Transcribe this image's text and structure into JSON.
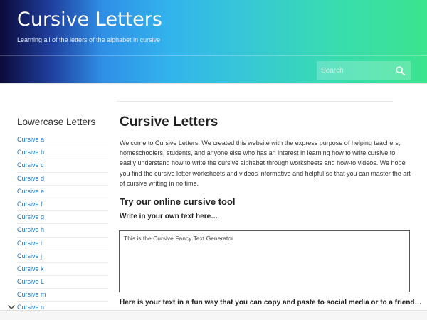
{
  "header": {
    "site_title": "Cursive Letters",
    "site_description": "Learning all of the letters of the alphabet in cursive",
    "search": {
      "placeholder": "Search",
      "icon": "search-icon"
    }
  },
  "sidebar": {
    "title": "Lowercase Letters",
    "items": [
      {
        "label": "Cursive a"
      },
      {
        "label": "Cursive b"
      },
      {
        "label": "Cursive c"
      },
      {
        "label": "Cursive d"
      },
      {
        "label": "Cursive e"
      },
      {
        "label": "Cursive f"
      },
      {
        "label": "Cursive g"
      },
      {
        "label": "Cursive h"
      },
      {
        "label": "Cursive i"
      },
      {
        "label": "Cursive j"
      },
      {
        "label": "Cursive k"
      },
      {
        "label": "Cursive L"
      },
      {
        "label": "Cursive m"
      },
      {
        "label": "Cursive n"
      }
    ]
  },
  "main": {
    "title": "Cursive Letters",
    "intro": "Welcome to Cursive Letters! We created this website with the express purpose of helping teachers, homeschoolers, students, and anyone else who has an interest in learning how to write cursive to easily understand how to write the cursive alphabet through worksheets and how-to videos. We hope you find the cursive letter worksheets and videos informative and helpful so that you can master the art of cursive writing in no time.",
    "tool_heading": "Try our online cursive tool",
    "write_label": "Write in your own text here…",
    "textarea_value": "This is the Cursive Fancy Text Generator",
    "result_label": "Here is your text in a fun way that you can copy and paste to social media or to a friend…"
  },
  "colors": {
    "link": "#1e73be",
    "header_gradient_start": "#0b0a3a",
    "header_gradient_end": "#3be48e"
  }
}
